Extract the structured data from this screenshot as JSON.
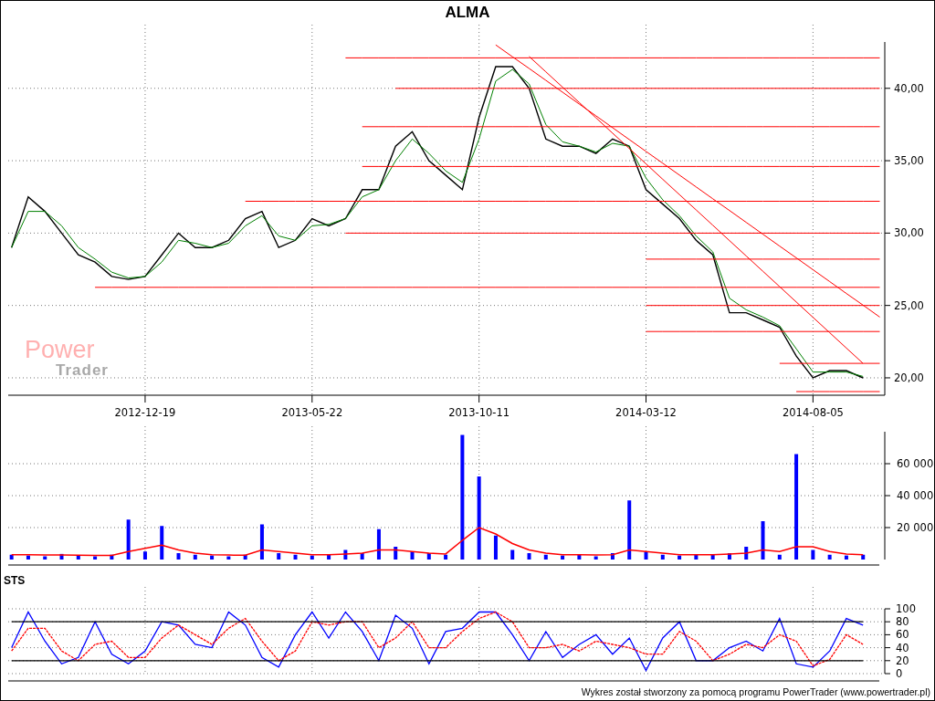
{
  "title": "ALMA",
  "logo": {
    "top": "Power",
    "bottom": "Trader"
  },
  "price_chart": {
    "chart_data": {
      "type": "line",
      "grid": true,
      "ylim": [
        18.8,
        43.2
      ],
      "categories": [
        null,
        null,
        null,
        null,
        null,
        null,
        null,
        null,
        "2012-12-19",
        null,
        null,
        null,
        null,
        null,
        null,
        null,
        null,
        null,
        "2013-05-22",
        null,
        null,
        null,
        null,
        null,
        null,
        null,
        null,
        null,
        "2013-10-11",
        null,
        null,
        null,
        null,
        null,
        null,
        null,
        null,
        null,
        "2014-03-12",
        null,
        null,
        null,
        null,
        null,
        null,
        null,
        null,
        null,
        "2014-08-05",
        null,
        null,
        null,
        null
      ],
      "yticks": [
        {
          "value": 20,
          "label": "20,00"
        },
        {
          "value": 25,
          "label": "25,00"
        },
        {
          "value": 30,
          "label": "30,00"
        },
        {
          "value": 35,
          "label": "35,00"
        },
        {
          "value": 40,
          "label": "40,00"
        }
      ],
      "series": [
        {
          "color": "#000000",
          "values": [
            29,
            32.5,
            31.5,
            30,
            28.5,
            28,
            27,
            26.8,
            27,
            28.5,
            30,
            29,
            29,
            29.5,
            31,
            31.5,
            29,
            29.5,
            31,
            30.5,
            31,
            33,
            33,
            36,
            37,
            35,
            34,
            33,
            38,
            41.5,
            41.5,
            40,
            36.5,
            36,
            36,
            35.5,
            36.5,
            36,
            33,
            32,
            31,
            29.5,
            28.5,
            24.5,
            24.5,
            24,
            23.5,
            21.5,
            20,
            20.5,
            20.5,
            20,
            null
          ]
        },
        {
          "color": "#008000",
          "values": [
            29,
            31.5,
            31.5,
            30.5,
            29,
            28.2,
            27.3,
            26.9,
            27,
            28,
            29.5,
            29.3,
            29,
            29.3,
            30.5,
            31.2,
            29.8,
            29.5,
            30.5,
            30.6,
            31,
            32.5,
            33,
            35,
            36.5,
            35.5,
            34.3,
            33.5,
            36.5,
            40.5,
            41.3,
            40.3,
            37.5,
            36.3,
            36,
            35.6,
            36.2,
            36,
            33.8,
            32.3,
            31.2,
            29.8,
            28.7,
            25.5,
            24.7,
            24.2,
            23.6,
            22,
            20.4,
            20.4,
            20.4,
            20.1,
            null
          ]
        },
        {
          "color": "#ff0000",
          "values": [
            null,
            null,
            null,
            null,
            null,
            null,
            null,
            null,
            null,
            null,
            null,
            null,
            null,
            null,
            null,
            null,
            null,
            null,
            null,
            null,
            42.1,
            42.1,
            42.1,
            42.1,
            42.1,
            42.1,
            42.1,
            42.1,
            42.1,
            42.1,
            42.1,
            42.1,
            42.1,
            42.1,
            42.1,
            42.1,
            42.1,
            42.1,
            42.1,
            42.1,
            42.1,
            42.1,
            42.1,
            42.1,
            42.1,
            42.1,
            42.1,
            42.1,
            42.1,
            42.1,
            42.1,
            42.1,
            42.1
          ]
        },
        {
          "color": "#ff0000",
          "values": [
            null,
            null,
            null,
            null,
            null,
            null,
            null,
            null,
            null,
            null,
            null,
            null,
            null,
            null,
            null,
            null,
            null,
            null,
            null,
            null,
            null,
            null,
            null,
            40,
            40,
            40,
            40,
            40,
            40,
            40,
            40,
            40,
            40,
            40,
            40,
            40,
            40,
            40,
            40,
            40,
            40,
            40,
            40,
            40,
            40,
            40,
            40,
            40,
            40,
            40,
            40,
            40,
            40
          ]
        },
        {
          "color": "#ff0000",
          "values": [
            null,
            null,
            null,
            null,
            null,
            null,
            null,
            null,
            null,
            null,
            null,
            null,
            null,
            null,
            null,
            null,
            null,
            null,
            null,
            null,
            null,
            37.35,
            37.35,
            37.35,
            37.35,
            37.35,
            37.35,
            37.35,
            37.35,
            37.35,
            37.35,
            37.35,
            37.35,
            37.35,
            37.35,
            37.35,
            37.35,
            37.35,
            37.35,
            37.35,
            37.35,
            37.35,
            37.35,
            37.35,
            37.35,
            37.35,
            37.35,
            37.35,
            37.35,
            37.35,
            37.35,
            37.35,
            37.35
          ]
        },
        {
          "color": "#ff0000",
          "values": [
            null,
            null,
            null,
            null,
            null,
            null,
            null,
            null,
            null,
            null,
            null,
            null,
            null,
            null,
            null,
            null,
            null,
            null,
            null,
            null,
            null,
            34.6,
            34.6,
            34.6,
            34.6,
            34.6,
            34.6,
            34.6,
            34.6,
            34.6,
            34.6,
            34.6,
            34.6,
            34.6,
            34.6,
            34.6,
            34.6,
            34.6,
            34.6,
            34.6,
            34.6,
            34.6,
            34.6,
            34.6,
            34.6,
            34.6,
            34.6,
            34.6,
            34.6,
            34.6,
            34.6,
            34.6,
            34.6
          ]
        },
        {
          "color": "#ff0000",
          "values": [
            null,
            null,
            null,
            null,
            null,
            null,
            null,
            null,
            null,
            null,
            null,
            null,
            null,
            null,
            32.2,
            32.2,
            32.2,
            32.2,
            32.2,
            32.2,
            32.2,
            32.2,
            32.2,
            32.2,
            32.2,
            32.2,
            32.2,
            32.2,
            32.2,
            32.2,
            32.2,
            32.2,
            32.2,
            32.2,
            32.2,
            32.2,
            32.2,
            32.2,
            32.2,
            32.2,
            32.2,
            32.2,
            32.2,
            32.2,
            32.2,
            32.2,
            32.2,
            32.2,
            32.2,
            32.2,
            32.2,
            32.2,
            32.2
          ]
        },
        {
          "color": "#ff0000",
          "values": [
            null,
            null,
            null,
            null,
            null,
            null,
            null,
            null,
            null,
            null,
            null,
            null,
            null,
            null,
            null,
            null,
            null,
            null,
            null,
            null,
            30,
            30,
            30,
            30,
            30,
            30,
            30,
            30,
            30,
            30,
            30,
            30,
            30,
            30,
            30,
            30,
            30,
            30,
            30,
            30,
            30,
            30,
            30,
            30,
            30,
            30,
            30,
            30,
            30,
            30,
            30,
            30,
            30
          ]
        },
        {
          "color": "#ff0000",
          "values": [
            null,
            null,
            null,
            null,
            null,
            null,
            null,
            null,
            null,
            null,
            null,
            null,
            null,
            null,
            null,
            null,
            null,
            null,
            null,
            null,
            null,
            null,
            null,
            null,
            null,
            null,
            null,
            null,
            null,
            null,
            null,
            null,
            null,
            null,
            null,
            null,
            null,
            null,
            28.2,
            28.2,
            28.2,
            28.2,
            28.2,
            28.2,
            28.2,
            28.2,
            28.2,
            28.2,
            28.2,
            28.2,
            28.2,
            28.2,
            28.2
          ]
        },
        {
          "color": "#ff0000",
          "values": [
            null,
            null,
            null,
            null,
            null,
            26.25,
            26.25,
            26.25,
            26.25,
            26.25,
            26.25,
            26.25,
            26.25,
            26.25,
            26.25,
            26.25,
            26.25,
            26.25,
            26.25,
            26.25,
            26.25,
            26.25,
            26.25,
            26.25,
            26.25,
            26.25,
            26.25,
            26.25,
            26.25,
            26.25,
            26.25,
            26.25,
            26.25,
            26.25,
            26.25,
            26.25,
            26.25,
            26.25,
            26.25,
            26.25,
            26.25,
            26.25,
            26.25,
            26.25,
            26.25,
            26.25,
            26.25,
            26.25,
            26.25,
            26.25,
            26.25,
            26.25,
            26.25
          ]
        },
        {
          "color": "#ff0000",
          "values": [
            null,
            null,
            null,
            null,
            null,
            null,
            null,
            null,
            null,
            null,
            null,
            null,
            null,
            null,
            null,
            null,
            null,
            null,
            null,
            null,
            null,
            null,
            null,
            null,
            null,
            null,
            null,
            null,
            null,
            null,
            null,
            null,
            null,
            null,
            null,
            null,
            null,
            null,
            25,
            25,
            25,
            25,
            25,
            25,
            25,
            25,
            25,
            25,
            25,
            25,
            25,
            25,
            25
          ]
        },
        {
          "color": "#ff0000",
          "values": [
            null,
            null,
            null,
            null,
            null,
            null,
            null,
            null,
            null,
            null,
            null,
            null,
            null,
            null,
            null,
            null,
            null,
            null,
            null,
            null,
            null,
            null,
            null,
            null,
            null,
            null,
            null,
            null,
            null,
            null,
            null,
            null,
            null,
            null,
            null,
            null,
            null,
            null,
            23.2,
            23.2,
            23.2,
            23.2,
            23.2,
            23.2,
            23.2,
            23.2,
            23.2,
            23.2,
            23.2,
            23.2,
            23.2,
            23.2,
            23.2
          ]
        },
        {
          "color": "#ff0000",
          "values": [
            null,
            null,
            null,
            null,
            null,
            null,
            null,
            null,
            null,
            null,
            null,
            null,
            null,
            null,
            null,
            null,
            null,
            null,
            null,
            null,
            null,
            null,
            null,
            null,
            null,
            null,
            null,
            null,
            null,
            null,
            null,
            null,
            null,
            null,
            null,
            null,
            null,
            null,
            null,
            null,
            null,
            null,
            null,
            null,
            null,
            null,
            21,
            21,
            21,
            21,
            21,
            21,
            21
          ]
        },
        {
          "color": "#ff0000",
          "values": [
            null,
            null,
            null,
            null,
            null,
            null,
            null,
            null,
            null,
            null,
            null,
            null,
            null,
            null,
            null,
            null,
            null,
            null,
            null,
            null,
            null,
            null,
            null,
            null,
            null,
            null,
            null,
            null,
            null,
            null,
            null,
            null,
            null,
            null,
            null,
            null,
            null,
            null,
            null,
            null,
            null,
            null,
            null,
            null,
            null,
            null,
            null,
            19.05,
            19.05,
            19.05,
            19.05,
            19.05,
            19.05
          ]
        },
        {
          "color": "#ff0000",
          "values": [
            null,
            null,
            null,
            null,
            null,
            null,
            null,
            null,
            null,
            null,
            null,
            null,
            null,
            null,
            null,
            null,
            null,
            null,
            null,
            null,
            null,
            null,
            null,
            null,
            null,
            null,
            null,
            null,
            null,
            43,
            42.18,
            41.37,
            40.55,
            39.73,
            38.91,
            38.1,
            37.28,
            36.46,
            35.64,
            34.83,
            34.01,
            33.19,
            32.37,
            31.56,
            30.74,
            29.92,
            29.1,
            28.29,
            27.47,
            26.65,
            25.83,
            25.02,
            24.2
          ]
        },
        {
          "color": "#ff0000",
          "values": [
            null,
            null,
            null,
            null,
            null,
            null,
            null,
            null,
            null,
            null,
            null,
            null,
            null,
            null,
            null,
            null,
            null,
            null,
            null,
            null,
            null,
            null,
            null,
            null,
            null,
            null,
            null,
            null,
            null,
            null,
            null,
            42.2,
            41.14,
            40.08,
            39.02,
            37.96,
            36.9,
            35.84,
            34.78,
            33.72,
            32.66,
            31.6,
            30.54,
            29.48,
            28.42,
            27.36,
            26.3,
            25.24,
            24.18,
            23.12,
            22.06,
            21,
            null
          ]
        }
      ]
    }
  },
  "volume_chart": {
    "chart_data": {
      "type": "bar",
      "grid": true,
      "categories": [
        null,
        null,
        null,
        null,
        null,
        null,
        null,
        null,
        null,
        null,
        null,
        null,
        null,
        null,
        null,
        null,
        null,
        null,
        null,
        null,
        null,
        null,
        null,
        null,
        null,
        null,
        null,
        null,
        null,
        null,
        null,
        null,
        null,
        null,
        null,
        null,
        null,
        null,
        null,
        null,
        null,
        null,
        null,
        null,
        null,
        null,
        null,
        null,
        null,
        null,
        null,
        null
      ],
      "ylim": [
        0,
        80000
      ],
      "yticks": [
        {
          "value": 20000,
          "label": "20 000"
        },
        {
          "value": 40000,
          "label": "40 000"
        },
        {
          "value": 60000,
          "label": "60 000"
        }
      ],
      "series": [
        {
          "color": "#0000ff",
          "values": [
            3000,
            2500,
            2000,
            3500,
            2500,
            2000,
            3000,
            25000,
            5000,
            21000,
            4000,
            3000,
            2500,
            2000,
            3000,
            22000,
            4000,
            3000,
            2500,
            3000,
            6000,
            4000,
            19000,
            8000,
            5000,
            4000,
            3000,
            78000,
            52000,
            15000,
            6000,
            4000,
            3000,
            2500,
            3000,
            2000,
            4000,
            37000,
            5000,
            3000,
            2500,
            3000,
            3000,
            4000,
            8000,
            24000,
            3000,
            66000,
            6000,
            3000,
            2500,
            3000
          ]
        },
        {
          "type": "line",
          "color": "#ff0000",
          "values": [
            3000,
            3000,
            2800,
            2800,
            2700,
            2500,
            2600,
            5000,
            7000,
            9000,
            6000,
            4000,
            3000,
            2800,
            2700,
            6000,
            5000,
            4000,
            3000,
            3000,
            3500,
            4000,
            6000,
            6000,
            5000,
            4000,
            3500,
            12000,
            20000,
            16000,
            10000,
            6000,
            4000,
            3000,
            3000,
            2800,
            3000,
            6000,
            5000,
            4000,
            3000,
            3000,
            3000,
            3500,
            4000,
            6000,
            5000,
            8000,
            8000,
            5000,
            3500,
            3000
          ]
        }
      ]
    }
  },
  "sts_chart": {
    "label": "STS",
    "chart_data": {
      "type": "line",
      "grid": true,
      "categories": [
        null,
        null,
        null,
        null,
        null,
        null,
        null,
        null,
        null,
        null,
        null,
        null,
        null,
        null,
        null,
        null,
        null,
        null,
        null,
        null,
        null,
        null,
        null,
        null,
        null,
        null,
        null,
        null,
        null,
        null,
        null,
        null,
        null,
        null,
        null,
        null,
        null,
        null,
        null,
        null,
        null,
        null,
        null,
        null,
        null,
        null,
        null,
        null,
        null,
        null,
        null,
        null
      ],
      "ylim": [
        0,
        100
      ],
      "yticks": [
        0,
        20,
        40,
        60,
        80,
        100
      ],
      "series": [
        {
          "color": "#0000ff",
          "values": [
            40,
            95,
            50,
            15,
            25,
            80,
            30,
            15,
            35,
            80,
            75,
            45,
            40,
            95,
            75,
            25,
            10,
            60,
            95,
            55,
            95,
            65,
            20,
            90,
            70,
            15,
            65,
            70,
            95,
            95,
            60,
            20,
            65,
            25,
            45,
            60,
            30,
            55,
            5,
            55,
            80,
            20,
            20,
            40,
            50,
            35,
            85,
            15,
            10,
            35,
            85,
            75
          ]
        },
        {
          "color": "#ff0000",
          "line_style": "dashed",
          "values": [
            35,
            70,
            70,
            35,
            20,
            45,
            50,
            25,
            25,
            55,
            75,
            60,
            45,
            70,
            85,
            50,
            20,
            35,
            80,
            75,
            80,
            80,
            40,
            55,
            80,
            40,
            40,
            65,
            85,
            95,
            80,
            40,
            40,
            45,
            35,
            50,
            45,
            40,
            30,
            30,
            65,
            50,
            20,
            30,
            45,
            40,
            60,
            50,
            12,
            22,
            60,
            45
          ]
        },
        {
          "color": "#000000",
          "values": [
            20,
            20,
            20,
            20,
            20,
            20,
            20,
            20,
            20,
            20,
            20,
            20,
            20,
            20,
            20,
            20,
            20,
            20,
            20,
            20,
            20,
            20,
            20,
            20,
            20,
            20,
            20,
            20,
            20,
            20,
            20,
            20,
            20,
            20,
            20,
            20,
            20,
            20,
            20,
            20,
            20,
            20,
            20,
            20,
            20,
            20,
            20,
            20,
            20,
            20,
            20,
            20
          ]
        },
        {
          "color": "#000000",
          "values": [
            80,
            80,
            80,
            80,
            80,
            80,
            80,
            80,
            80,
            80,
            80,
            80,
            80,
            80,
            80,
            80,
            80,
            80,
            80,
            80,
            80,
            80,
            80,
            80,
            80,
            80,
            80,
            80,
            80,
            80,
            80,
            80,
            80,
            80,
            80,
            80,
            80,
            80,
            80,
            80,
            80,
            80,
            80,
            80,
            80,
            80,
            80,
            80,
            80,
            80,
            80,
            80
          ]
        }
      ]
    }
  },
  "footer": "Wykres został stworzony za pomocą programu PowerTrader (www.powertrader.pl)"
}
